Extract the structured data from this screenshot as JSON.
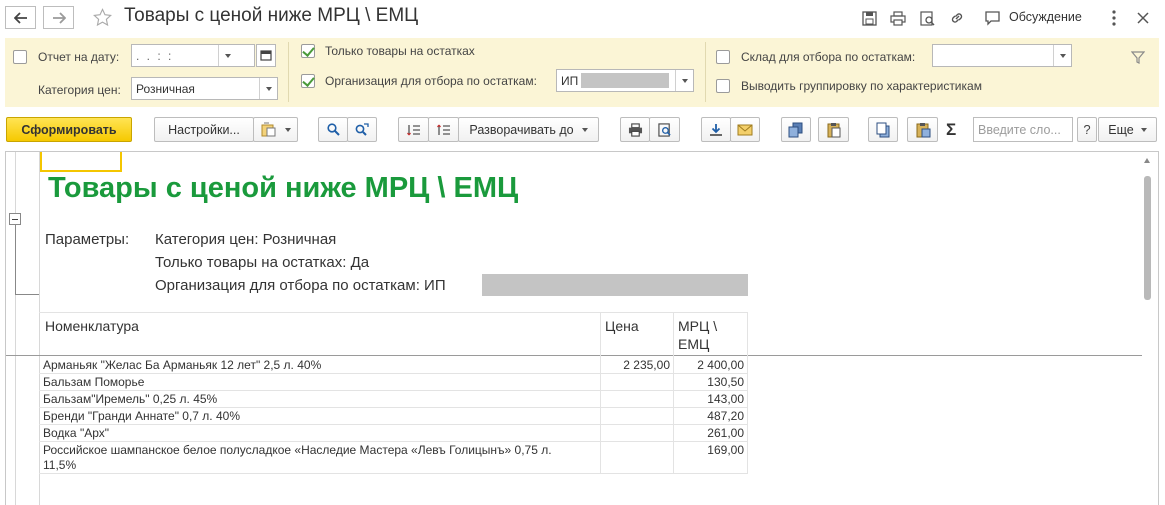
{
  "titlebar": {
    "back_icon": "arrow-left-icon",
    "forward_icon": "arrow-right-icon",
    "favorite_icon": "star-icon",
    "title": "Товары с ценой ниже МРЦ \\ ЕМЦ",
    "discuss_label": "Обсуждение"
  },
  "params": {
    "report_date_label": "Отчет на дату:",
    "report_date_value": " .  .      :  :",
    "price_category_label": "Категория цен:",
    "price_category_value": "Розничная",
    "only_in_stock_label": "Только товары на остатках",
    "only_in_stock_checked": true,
    "organization_label": "Организация для отбора по остаткам:",
    "organization_checked": true,
    "organization_value": "ИП",
    "warehouse_label": "Склад для отбора по остаткам:",
    "warehouse_checked": false,
    "grouping_label": "Выводить группировку по характеристикам",
    "grouping_checked": false
  },
  "toolbar": {
    "generate_label": "Сформировать",
    "settings_label": "Настройки...",
    "expand_label": "Разворачивать до",
    "search_placeholder": "Введите сло...",
    "more_label": "Еще"
  },
  "report": {
    "title": "Товары с ценой ниже МРЦ \\ ЕМЦ",
    "params_label": "Параметры:",
    "param_lines": [
      "Категория цен: Розничная",
      "Только товары на остатках: Да",
      "Организация для отбора по остаткам: ИП"
    ],
    "columns": [
      "Номенклатура",
      "Цена",
      "МРЦ \\",
      "ЕМЦ"
    ],
    "rows": [
      {
        "name": "Арманьяк \"Желас Ба Арманьяк 12 лет\" 2,5 л. 40%",
        "price": "2 235,00",
        "mrc": "2 400,00"
      },
      {
        "name": "Бальзам Поморье",
        "price": "",
        "mrc": "130,50"
      },
      {
        "name": "Бальзам\"Иремель\" 0,25 л. 45%",
        "price": "",
        "mrc": "143,00"
      },
      {
        "name": "Бренди \"Гранди Аннате\" 0,7 л. 40%",
        "price": "",
        "mrc": "487,20"
      },
      {
        "name": "Водка \"Арх\"",
        "price": "",
        "mrc": "261,00"
      },
      {
        "name": "Российское шампанское белое полусладкое «Наследие Мастера «Левъ Голицынъ» 0,75 л.",
        "name2": "11,5%",
        "price": "",
        "mrc": "169,00"
      }
    ]
  },
  "colors": {
    "accent_yellow": "#f6c900",
    "params_bg": "#fbf5d6",
    "report_title": "#1a9a3c",
    "check_green": "#4a9a3a"
  }
}
